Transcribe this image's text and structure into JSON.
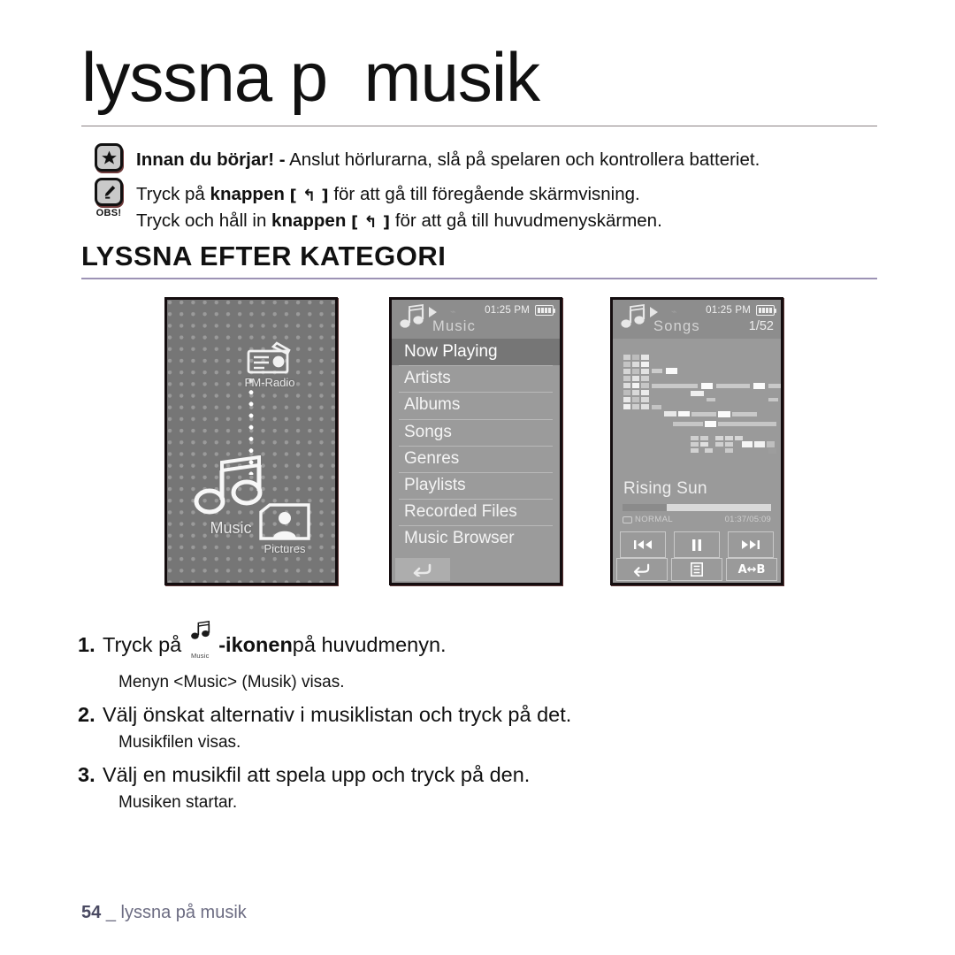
{
  "page": {
    "title": "lyssna på musik",
    "title_render": "lyssna p  musik",
    "section_heading": "LYSSNA EFTER KATEGORI",
    "footer_page": "54",
    "footer_sep": "_",
    "footer_text": "lyssna på musik",
    "rule_color": "#9d93b5",
    "footer_color": "#6c6c82"
  },
  "notes": {
    "before_you_start": {
      "icon": "star-icon",
      "label_bold": "Innan du börjar! -",
      "text": " Anslut hörlurarna, slå på spelaren och kontrollera batteriet."
    },
    "note": {
      "icon": "hand-pen-icon",
      "icon_label": "OBS!",
      "line1_pre": "Tryck på ",
      "line1_bold": "knappen",
      "line1_key": "[ ↰ ]",
      "line1_post": " för att gå till föregående skärmvisning.",
      "line2_pre": "Tryck och håll in ",
      "line2_bold": "knappen",
      "line2_key": "[ ↰ ]",
      "line2_post": " för att gå till huvudmenyskärmen."
    }
  },
  "screens": {
    "main_menu": {
      "name": "Main menu",
      "icons": [
        {
          "id": "fm-radio",
          "label": "FM-Radio"
        },
        {
          "id": "music",
          "label": "Music"
        },
        {
          "id": "pictures",
          "label": "Pictures"
        }
      ]
    },
    "music_menu": {
      "status": {
        "time": "01:25 PM",
        "battery": "full"
      },
      "title": "Music",
      "items": [
        {
          "label": "Now Playing",
          "selected": true
        },
        {
          "label": "Artists",
          "selected": false
        },
        {
          "label": "Albums",
          "selected": false
        },
        {
          "label": "Songs",
          "selected": false
        },
        {
          "label": "Genres",
          "selected": false
        },
        {
          "label": "Playlists",
          "selected": false
        },
        {
          "label": "Recorded Files",
          "selected": false
        },
        {
          "label": "Music Browser",
          "selected": false
        }
      ],
      "back_button": "↰"
    },
    "now_playing": {
      "status": {
        "time": "01:25 PM",
        "battery": "full"
      },
      "title": "Songs",
      "counter": "1/52",
      "track": "Rising Sun",
      "progress_percent": 30,
      "repeat_mode": "NORMAL",
      "elapsed": "01:37/05:09",
      "controls": [
        {
          "id": "prev",
          "glyph": "◀◀"
        },
        {
          "id": "pause",
          "glyph": "❚❚"
        },
        {
          "id": "next",
          "glyph": "▶▶"
        }
      ],
      "bottom": [
        {
          "id": "back",
          "glyph": "↰"
        },
        {
          "id": "menu",
          "glyph": "▤"
        },
        {
          "id": "ab-repeat",
          "glyph": "A↔B"
        }
      ]
    }
  },
  "steps": [
    {
      "num": "1.",
      "pre": "Tryck på",
      "icon_label": "Music",
      "bold": "-ikonen",
      "post": " på huvudmenyn.",
      "sub": "Menyn <Music> (Musik) visas."
    },
    {
      "num": "2.",
      "text": "Välj önskat alternativ i musiklistan och tryck på det.",
      "sub": "Musikfilen visas."
    },
    {
      "num": "3.",
      "text": "Välj en musikfil att spela upp och tryck på den.",
      "sub": "Musiken startar."
    }
  ]
}
